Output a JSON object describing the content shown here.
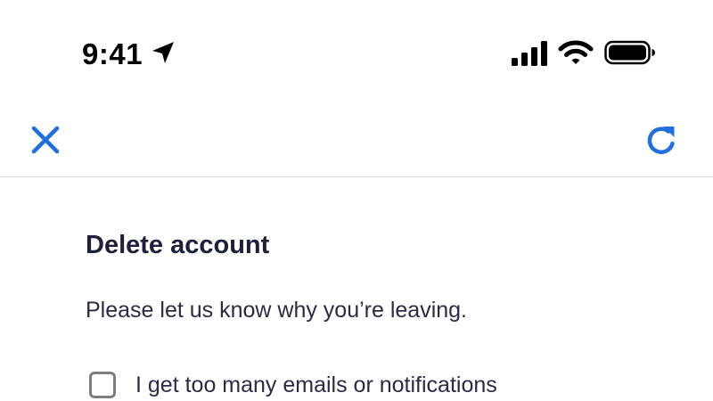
{
  "status_bar": {
    "time": "9:41",
    "icons": [
      "location-arrow-icon",
      "cellular-signal-icon",
      "wifi-icon",
      "battery-icon"
    ]
  },
  "nav": {
    "close_icon": "close-icon",
    "refresh_icon": "refresh-icon",
    "accent_color": "#1f6fe0"
  },
  "content": {
    "title": "Delete account",
    "subtitle": "Please let us know why you’re leaving.",
    "options": [
      {
        "label": "I get too many emails or notifications",
        "checked": false
      }
    ]
  }
}
